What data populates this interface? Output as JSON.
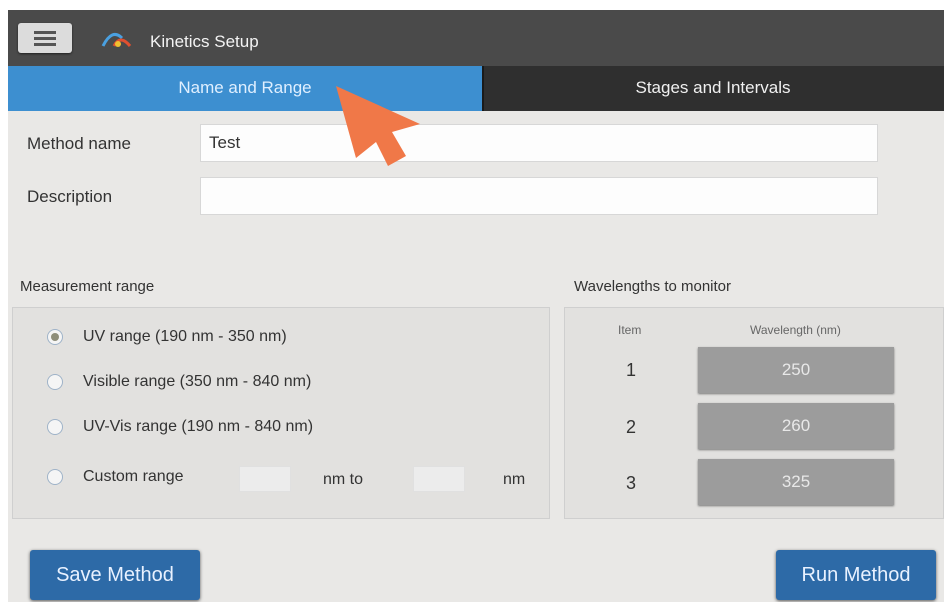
{
  "header": {
    "title": "Kinetics Setup"
  },
  "tabs": [
    {
      "label": "Name and Range",
      "active": true
    },
    {
      "label": "Stages and Intervals",
      "active": false
    }
  ],
  "form": {
    "method_name_label": "Method name",
    "method_name_value": "Test",
    "description_label": "Description",
    "description_value": ""
  },
  "measurement": {
    "label": "Measurement range",
    "options": [
      {
        "label": "UV range (190 nm - 350 nm)",
        "checked": true
      },
      {
        "label": "Visible range (350 nm - 840 nm)",
        "checked": false
      },
      {
        "label": "UV-Vis range (190 nm - 840 nm)",
        "checked": false
      },
      {
        "label": "Custom range",
        "checked": false
      }
    ],
    "nm_to": "nm to",
    "nm": "nm"
  },
  "wavelengths": {
    "label": "Wavelengths to monitor",
    "col_item": "Item",
    "col_wavelength": "Wavelength (nm)",
    "rows": [
      {
        "item": "1",
        "wavelength": "250"
      },
      {
        "item": "2",
        "wavelength": "260"
      },
      {
        "item": "3",
        "wavelength": "325"
      }
    ]
  },
  "buttons": {
    "save": "Save Method",
    "run": "Run Method"
  },
  "colors": {
    "accent": "#3d8fd0",
    "button": "#2d6aa7",
    "pointer": "#f07848"
  }
}
